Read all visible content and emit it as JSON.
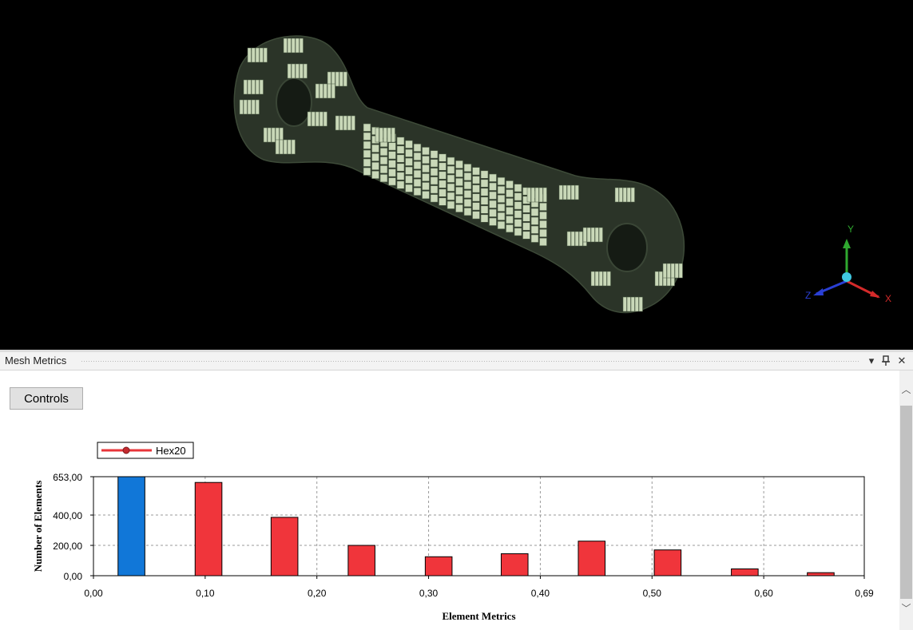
{
  "viewport": {
    "triad": {
      "x_label": "X",
      "y_label": "Y",
      "z_label": "Z",
      "x_color": "#d42a2a",
      "y_color": "#2fa82f",
      "z_color": "#2a3fd4",
      "origin_color": "#40c8e0"
    },
    "model_color": "#2b3428",
    "element_color": "#c9d8b8"
  },
  "panel": {
    "title": "Mesh Metrics",
    "controls_label": "Controls",
    "dropdown_glyph": "▾",
    "pin_glyph": "ꟷ",
    "close_glyph": "✕",
    "scroll_up": "︿",
    "scroll_down": "﹀"
  },
  "chart_data": {
    "type": "bar",
    "xlabel": "Element Metrics",
    "ylabel": "Number of Elements",
    "xlim": [
      0.0,
      0.69
    ],
    "ylim": [
      0,
      653
    ],
    "x_ticks": [
      "0,00",
      "0,10",
      "0,20",
      "0,30",
      "0,40",
      "0,50",
      "0,60",
      "0,69"
    ],
    "x_tick_values": [
      0.0,
      0.1,
      0.2,
      0.3,
      0.4,
      0.5,
      0.6,
      0.69
    ],
    "y_ticks": [
      "0,00",
      "200,00",
      "400,00",
      "653,00"
    ],
    "y_tick_values": [
      0,
      200,
      400,
      653
    ],
    "grid": true,
    "legend": {
      "position": "top-left",
      "entries": [
        {
          "name": "Hex20",
          "color": "#e8343a"
        }
      ]
    },
    "bar_width": 0.024,
    "series": [
      {
        "name": "Hex20",
        "color": "#f0353b",
        "highlight_color": "#1177d8",
        "highlight_index": 0,
        "x": [
          0.034,
          0.103,
          0.171,
          0.24,
          0.309,
          0.377,
          0.446,
          0.514,
          0.583,
          0.651
        ],
        "values": [
          653,
          615,
          385,
          200,
          125,
          145,
          228,
          170,
          45,
          20
        ]
      }
    ]
  }
}
